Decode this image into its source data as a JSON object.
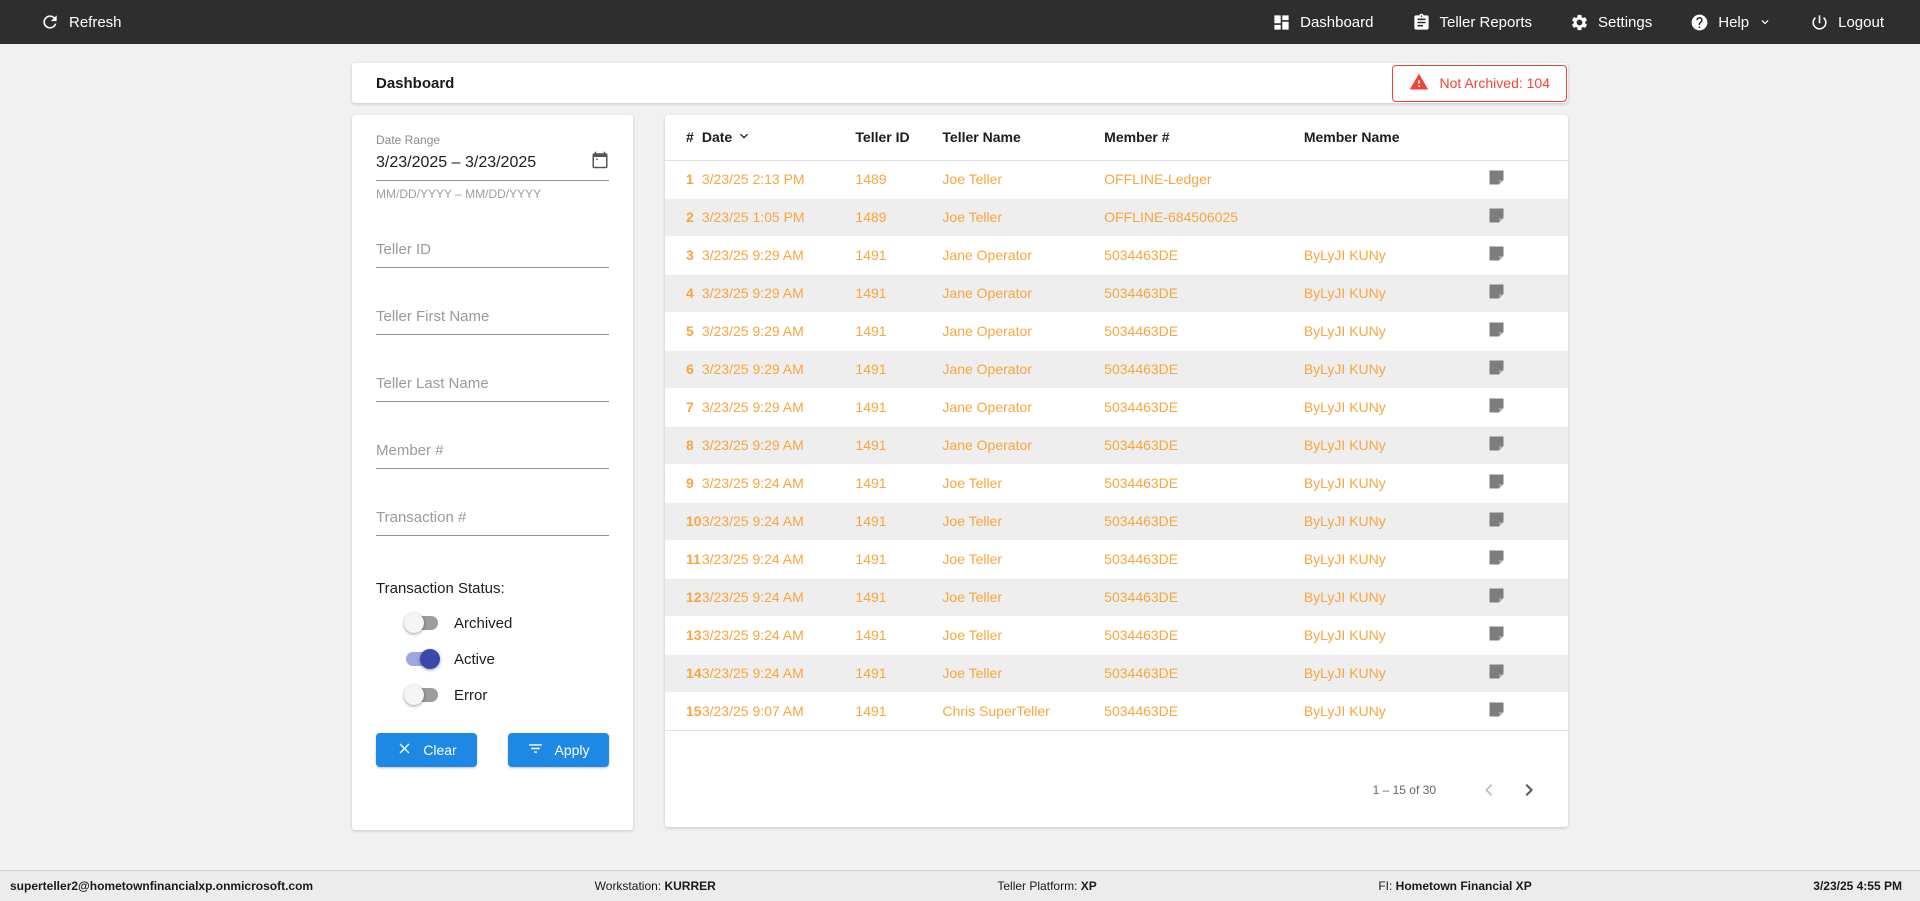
{
  "topbar": {
    "refresh_label": "Refresh",
    "nav": [
      {
        "label": "Dashboard",
        "icon": "dashboard-icon"
      },
      {
        "label": "Teller Reports",
        "icon": "reports-icon"
      },
      {
        "label": "Settings",
        "icon": "settings-icon"
      },
      {
        "label": "Help",
        "icon": "help-icon"
      },
      {
        "label": "Logout",
        "icon": "logout-icon"
      }
    ]
  },
  "header": {
    "title": "Dashboard",
    "not_archived_label": "Not Archived: 104"
  },
  "filters": {
    "date_range": {
      "label": "Date Range",
      "value": "3/23/2025 – 3/23/2025",
      "helper": "MM/DD/YYYY – MM/DD/YYYY"
    },
    "teller_id_placeholder": "Teller ID",
    "teller_first_placeholder": "Teller First Name",
    "teller_last_placeholder": "Teller Last Name",
    "member_num_placeholder": "Member #",
    "transaction_num_placeholder": "Transaction #",
    "status": {
      "label": "Transaction Status:",
      "toggles": [
        {
          "label": "Archived",
          "on": false
        },
        {
          "label": "Active",
          "on": true
        },
        {
          "label": "Error",
          "on": false
        }
      ]
    },
    "clear_label": "Clear",
    "apply_label": "Apply"
  },
  "table": {
    "columns": {
      "num": "#",
      "date": "Date",
      "teller_id": "Teller ID",
      "teller_name": "Teller Name",
      "member_num": "Member #",
      "member_name": "Member Name"
    },
    "sorted_column": "Date",
    "sort_direction": "desc",
    "rows": [
      {
        "num": "1",
        "date": "3/23/25 2:13 PM",
        "teller_id": "1489",
        "teller_name": "Joe Teller",
        "member_num": "OFFLINE-Ledger",
        "member_name": ""
      },
      {
        "num": "2",
        "date": "3/23/25 1:05 PM",
        "teller_id": "1489",
        "teller_name": "Joe Teller",
        "member_num": "OFFLINE-684506025",
        "member_name": ""
      },
      {
        "num": "3",
        "date": "3/23/25 9:29 AM",
        "teller_id": "1491",
        "teller_name": "Jane Operator",
        "member_num": "5034463DE",
        "member_name": "ByLyJI KUNy"
      },
      {
        "num": "4",
        "date": "3/23/25 9:29 AM",
        "teller_id": "1491",
        "teller_name": "Jane Operator",
        "member_num": "5034463DE",
        "member_name": "ByLyJI KUNy"
      },
      {
        "num": "5",
        "date": "3/23/25 9:29 AM",
        "teller_id": "1491",
        "teller_name": "Jane Operator",
        "member_num": "5034463DE",
        "member_name": "ByLyJI KUNy"
      },
      {
        "num": "6",
        "date": "3/23/25 9:29 AM",
        "teller_id": "1491",
        "teller_name": "Jane Operator",
        "member_num": "5034463DE",
        "member_name": "ByLyJI KUNy"
      },
      {
        "num": "7",
        "date": "3/23/25 9:29 AM",
        "teller_id": "1491",
        "teller_name": "Jane Operator",
        "member_num": "5034463DE",
        "member_name": "ByLyJI KUNy"
      },
      {
        "num": "8",
        "date": "3/23/25 9:29 AM",
        "teller_id": "1491",
        "teller_name": "Jane Operator",
        "member_num": "5034463DE",
        "member_name": "ByLyJI KUNy"
      },
      {
        "num": "9",
        "date": "3/23/25 9:24 AM",
        "teller_id": "1491",
        "teller_name": "Joe Teller",
        "member_num": "5034463DE",
        "member_name": "ByLyJI KUNy"
      },
      {
        "num": "10",
        "date": "3/23/25 9:24 AM",
        "teller_id": "1491",
        "teller_name": "Joe Teller",
        "member_num": "5034463DE",
        "member_name": "ByLyJI KUNy"
      },
      {
        "num": "11",
        "date": "3/23/25 9:24 AM",
        "teller_id": "1491",
        "teller_name": "Joe Teller",
        "member_num": "5034463DE",
        "member_name": "ByLyJI KUNy"
      },
      {
        "num": "12",
        "date": "3/23/25 9:24 AM",
        "teller_id": "1491",
        "teller_name": "Joe Teller",
        "member_num": "5034463DE",
        "member_name": "ByLyJI KUNy"
      },
      {
        "num": "13",
        "date": "3/23/25 9:24 AM",
        "teller_id": "1491",
        "teller_name": "Joe Teller",
        "member_num": "5034463DE",
        "member_name": "ByLyJI KUNy"
      },
      {
        "num": "14",
        "date": "3/23/25 9:24 AM",
        "teller_id": "1491",
        "teller_name": "Joe Teller",
        "member_num": "5034463DE",
        "member_name": "ByLyJI KUNy"
      },
      {
        "num": "15",
        "date": "3/23/25 9:07 AM",
        "teller_id": "1491",
        "teller_name": "Chris SuperTeller",
        "member_num": "5034463DE",
        "member_name": "ByLyJI KUNy"
      }
    ],
    "pagination": {
      "range": "1 – 15 of 30"
    }
  },
  "footer": {
    "user": "superteller2@hometownfinancialxp.onmicrosoft.com",
    "workstation_label": "Workstation:",
    "workstation": "KURRER",
    "platform_label": "Teller Platform:",
    "platform": "XP",
    "fi_label": "FI:",
    "fi": "Hometown Financial XP",
    "datetime": "3/23/25 4:55 PM"
  },
  "colors": {
    "topbar_bg": "#2e2e2e",
    "accent_blue": "#1e88e5",
    "data_orange": "#f8a63c",
    "alert_red": "#f44336",
    "toggle_on": "#3949ab",
    "row_stripe": "#eeeeee"
  }
}
